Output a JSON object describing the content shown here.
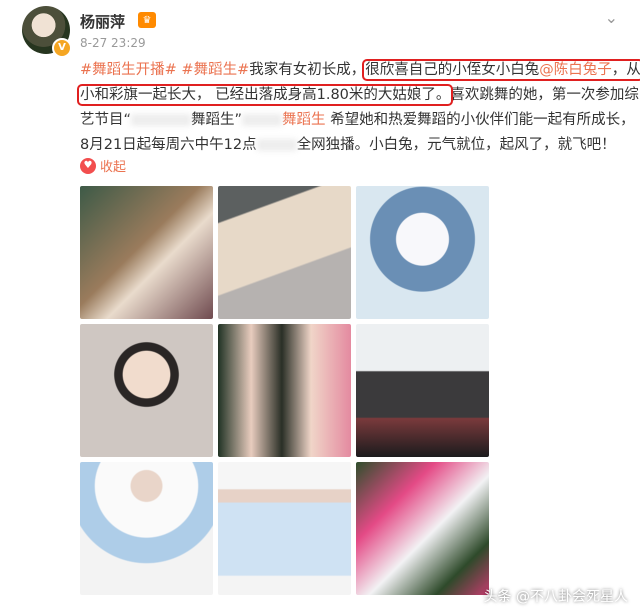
{
  "post": {
    "username": "杨丽萍",
    "timestamp": "8-27 23:29",
    "more": "⌄",
    "lines": [
      {
        "tag1": "#舞蹈生开播#",
        "tag2": "#舞蹈生#",
        "text": "我家有女初长成，",
        "hl1": "很欣喜自己的小侄女小白兔",
        "mention": "@陈白兔子",
        "hl1b": "，从"
      },
      {
        "hl2": "小和彩旗一起长大， 已经出落成身高1.80米的大姑娘了。",
        "rest": "喜欢跳舞的她，第一次参加综"
      },
      {
        "a": "艺节目“",
        "b": "舞蹈生",
        "c": "希望她和热爱舞蹈的小伙伴们能一起有所成长，"
      },
      {
        "a": "8月21日起每周六中午12点",
        "b": "全网独播。小白兔，元气就位，起风了，就飞吧！"
      }
    ],
    "favorite_label": "收起",
    "watermark": "头条 @不八卦会死星人"
  },
  "icons": {
    "verified": "v-badge-icon",
    "crown": "member-crown-icon",
    "heart": "heart-icon",
    "chevron": "chevron-down-icon"
  }
}
